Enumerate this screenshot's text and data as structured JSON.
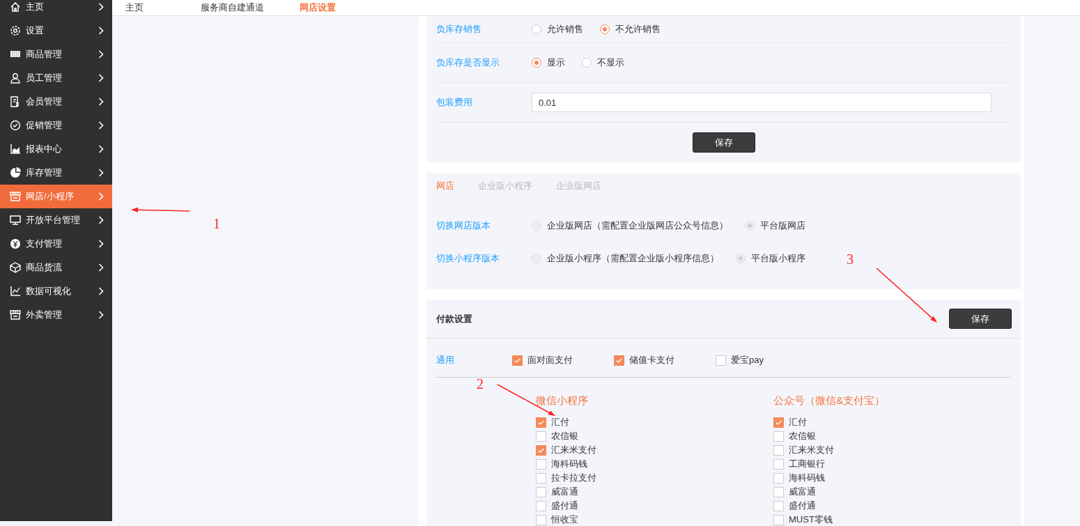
{
  "sidebar": {
    "items": [
      {
        "label": "主页",
        "selected": false
      },
      {
        "label": "设置",
        "selected": false
      },
      {
        "label": "商品管理",
        "selected": false
      },
      {
        "label": "员工管理",
        "selected": false
      },
      {
        "label": "会员管理",
        "selected": false
      },
      {
        "label": "促销管理",
        "selected": false
      },
      {
        "label": "报表中心",
        "selected": false
      },
      {
        "label": "库存管理",
        "selected": false
      },
      {
        "label": "网店/小程序",
        "selected": true
      },
      {
        "label": "开放平台管理",
        "selected": false
      },
      {
        "label": "支付管理",
        "selected": false
      },
      {
        "label": "商品货流",
        "selected": false
      },
      {
        "label": "数据可视化",
        "selected": false
      },
      {
        "label": "外卖管理",
        "selected": false
      }
    ]
  },
  "top_tabs": [
    {
      "label": "主页",
      "selected": false
    },
    {
      "label": "服务商自建通道",
      "selected": false
    },
    {
      "label": "网店设置",
      "selected": true
    }
  ],
  "stock_settings": {
    "rows": [
      {
        "kind": "radio",
        "label": "负库存销售",
        "options": [
          {
            "label": "允许销售",
            "selected": false
          },
          {
            "label": "不允许销售",
            "selected": true
          }
        ]
      },
      {
        "kind": "radio",
        "label": "负库存是否显示",
        "options": [
          {
            "label": "显示",
            "selected": true
          },
          {
            "label": "不显示",
            "selected": false
          }
        ]
      },
      {
        "kind": "input",
        "label": "包装费用",
        "value": "0.01"
      }
    ],
    "save_button": "保存"
  },
  "store_version": {
    "tabs": [
      {
        "label": "网店",
        "selected": true
      },
      {
        "label": "企业版小程序",
        "selected": false
      },
      {
        "label": "企业版网店",
        "selected": false
      }
    ],
    "rows": [
      {
        "label": "切换网店版本",
        "disabled": true,
        "options": [
          {
            "label": "企业版网店（需配置企业版网店公众号信息）",
            "selected": false
          },
          {
            "label": "平台版网店",
            "selected": true
          }
        ]
      },
      {
        "label": "切换小程序版本",
        "disabled": true,
        "options": [
          {
            "label": "企业版小程序（需配置企业版小程序信息）",
            "selected": false
          },
          {
            "label": "平台版小程序",
            "selected": true
          }
        ]
      }
    ]
  },
  "payment": {
    "title": "付款设置",
    "save_button": "保存",
    "general": {
      "label": "通用",
      "options": [
        {
          "label": "面对面支付",
          "checked": true
        },
        {
          "label": "储值卡支付",
          "checked": true
        },
        {
          "label": "爱宝pay",
          "checked": false
        }
      ]
    },
    "columns": [
      {
        "title": "微信小程序",
        "items": [
          {
            "label": "汇付",
            "checked": true
          },
          {
            "label": "农信银",
            "checked": false
          },
          {
            "label": "汇来米支付",
            "checked": true
          },
          {
            "label": "海科码钱",
            "checked": false
          },
          {
            "label": "拉卡拉支付",
            "checked": false
          },
          {
            "label": "威富通",
            "checked": false
          },
          {
            "label": "盛付通",
            "checked": false
          },
          {
            "label": "恒收宝",
            "checked": false
          }
        ]
      },
      {
        "title": "公众号（微信&支付宝）",
        "items": [
          {
            "label": "汇付",
            "checked": true
          },
          {
            "label": "农信银",
            "checked": false
          },
          {
            "label": "汇来米支付",
            "checked": false
          },
          {
            "label": "工商银行",
            "checked": false
          },
          {
            "label": "海科码钱",
            "checked": false
          },
          {
            "label": "威富通",
            "checked": false
          },
          {
            "label": "盛付通",
            "checked": false
          },
          {
            "label": "MUST零钱",
            "checked": false
          }
        ]
      }
    ]
  },
  "annotations": [
    {
      "label": "1"
    },
    {
      "label": "2"
    },
    {
      "label": "3"
    }
  ]
}
